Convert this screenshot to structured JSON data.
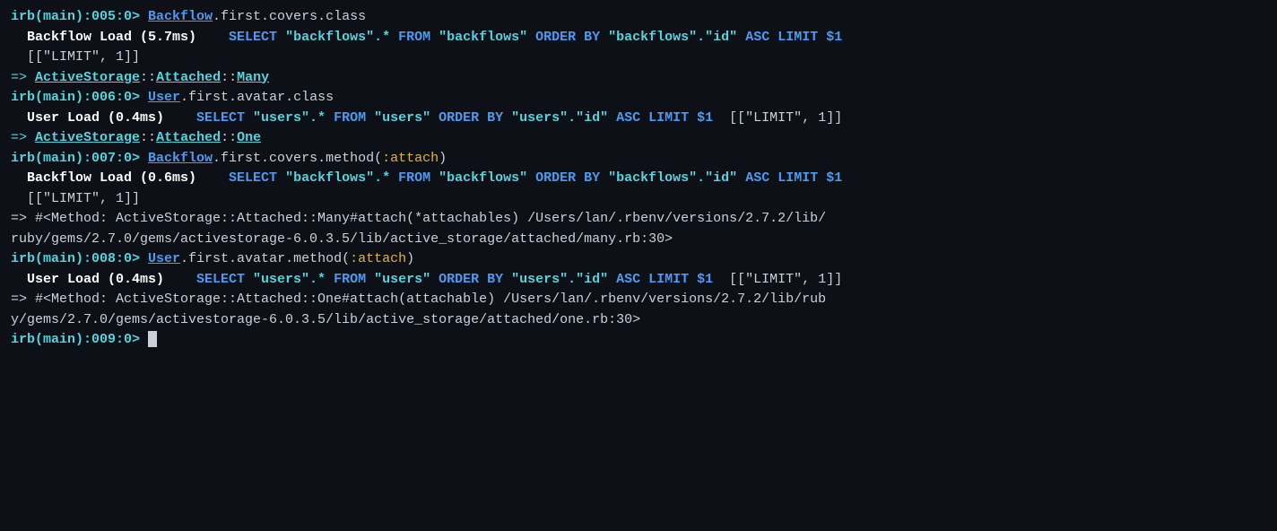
{
  "terminal": {
    "lines": [
      {
        "id": "line1",
        "type": "input",
        "prompt": "irb(main):005:0> ",
        "command": "Backflow.first.covers.class"
      },
      {
        "id": "line2",
        "type": "load",
        "prefix": "  Backflow Load (5.7ms)  ",
        "sql": "SELECT \"backflows\".* FROM \"backflows\" ORDER BY \"backflows\".\"id\" ASC LIMIT $1"
      },
      {
        "id": "line3",
        "type": "plain",
        "content": "  [[\"LIMIT\", 1]]"
      },
      {
        "id": "line4",
        "type": "result",
        "arrow": "=> ",
        "value": "ActiveStorage::Attached::Many"
      },
      {
        "id": "line5",
        "type": "input",
        "prompt": "irb(main):006:0> ",
        "command": "User.first.avatar.class"
      },
      {
        "id": "line6",
        "type": "load",
        "prefix": "  User Load (0.4ms)  ",
        "sql": "SELECT \"users\".* FROM \"users\" ORDER BY \"users\".\"id\" ASC LIMIT $1   [[\"LIMIT\", 1]]"
      },
      {
        "id": "line7",
        "type": "result",
        "arrow": "=> ",
        "value": "ActiveStorage::Attached::One"
      },
      {
        "id": "line8",
        "type": "input",
        "prompt": "irb(main):007:0> ",
        "command": "Backflow.first.covers.method(:attach)"
      },
      {
        "id": "line9",
        "type": "load",
        "prefix": "  Backflow Load (0.6ms)  ",
        "sql": "SELECT \"backflows\".* FROM \"backflows\" ORDER BY \"backflows\".\"id\" ASC LIMIT $1"
      },
      {
        "id": "line10",
        "type": "plain",
        "content": "  [[\"LIMIT\", 1]]"
      },
      {
        "id": "line11",
        "type": "plain",
        "content": "=> #<Method: ActiveStorage::Attached::Many#attach(*attachables) /Users/lan/.rbenv/versions/2.7.2/lib/"
      },
      {
        "id": "line12",
        "type": "plain",
        "content": "ruby/gems/2.7.0/gems/activestorage-6.0.3.5/lib/active_storage/attached/many.rb:30>"
      },
      {
        "id": "line13",
        "type": "input",
        "prompt": "irb(main):008:0> ",
        "command": "User.first.avatar.method(:attach)"
      },
      {
        "id": "line14",
        "type": "load",
        "prefix": "  User Load (0.4ms)  ",
        "sql": "SELECT \"users\".* FROM \"users\" ORDER BY \"users\".\"id\" ASC LIMIT $1   [[\"LIMIT\", 1]]"
      },
      {
        "id": "line15",
        "type": "plain",
        "content": "=> #<Method: ActiveStorage::Attached::One#attach(attachable) /Users/lan/.rbenv/versions/2.7.2/lib/rub"
      },
      {
        "id": "line16",
        "type": "plain",
        "content": "y/gems/2.7.0/gems/activestorage-6.0.3.5/lib/active_storage/attached/one.rb:30>"
      },
      {
        "id": "line17",
        "type": "cursor_line",
        "prompt": "irb(main):009:0> "
      }
    ],
    "colors": {
      "background": "#0d1117",
      "prompt": "#56d4dd",
      "command_class": "#4e9af1",
      "command_symbol": "#e3b341",
      "load_label": "#ffffff",
      "sql_keyword": "#4e9af1",
      "result_namespace": "#56d4dd",
      "arrow": "#56d4dd"
    }
  }
}
